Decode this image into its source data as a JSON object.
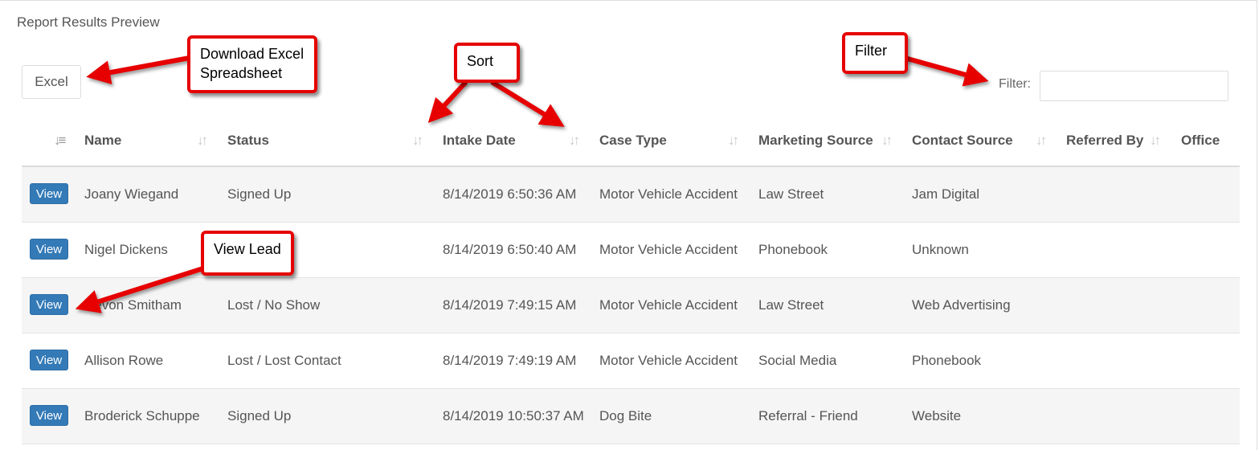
{
  "panel": {
    "title": "Report Results Preview"
  },
  "toolbar": {
    "excel_label": "Excel"
  },
  "filter": {
    "label": "Filter:",
    "placeholder": "",
    "value": ""
  },
  "table": {
    "headers": {
      "name": "Name",
      "status": "Status",
      "intake_date": "Intake Date",
      "case_type": "Case Type",
      "marketing_source": "Marketing Source",
      "contact_source": "Contact Source",
      "referred_by": "Referred By",
      "office": "Office"
    },
    "sort_active_icon": "sort-ascending-icon",
    "sort_icon": "sort-both-icon",
    "view_label": "View",
    "rows": [
      {
        "name": "Joany Wiegand",
        "status": "Signed Up",
        "intake_date": "8/14/2019 6:50:36 AM",
        "case_type": "Motor Vehicle Accident",
        "marketing_source": "Law Street",
        "contact_source": "Jam Digital",
        "referred_by": "",
        "office": ""
      },
      {
        "name": "Nigel Dickens",
        "status": "",
        "intake_date": "8/14/2019 6:50:40 AM",
        "case_type": "Motor Vehicle Accident",
        "marketing_source": "Phonebook",
        "contact_source": "Unknown",
        "referred_by": "",
        "office": ""
      },
      {
        "name": "Devon Smitham",
        "status": "Lost / No Show",
        "intake_date": "8/14/2019 7:49:15 AM",
        "case_type": "Motor Vehicle Accident",
        "marketing_source": "Law Street",
        "contact_source": "Web Advertising",
        "referred_by": "",
        "office": ""
      },
      {
        "name": "Allison Rowe",
        "status": "Lost / Lost Contact",
        "intake_date": "8/14/2019 7:49:19 AM",
        "case_type": "Motor Vehicle Accident",
        "marketing_source": "Social Media",
        "contact_source": "Phonebook",
        "referred_by": "",
        "office": ""
      },
      {
        "name": "Broderick Schuppe",
        "status": "Signed Up",
        "intake_date": "8/14/2019 10:50:37 AM",
        "case_type": "Dog Bite",
        "marketing_source": "Referral - Friend",
        "contact_source": "Website",
        "referred_by": "",
        "office": ""
      }
    ]
  },
  "annotations": {
    "download": {
      "line1": "Download Excel",
      "line2": "Spreadsheet"
    },
    "sort": "Sort",
    "filter": "Filter",
    "view_lead": "View Lead"
  },
  "colors": {
    "view_button": "#337ab7",
    "callout_border": "#e60000",
    "striped_row": "#f5f5f5"
  }
}
